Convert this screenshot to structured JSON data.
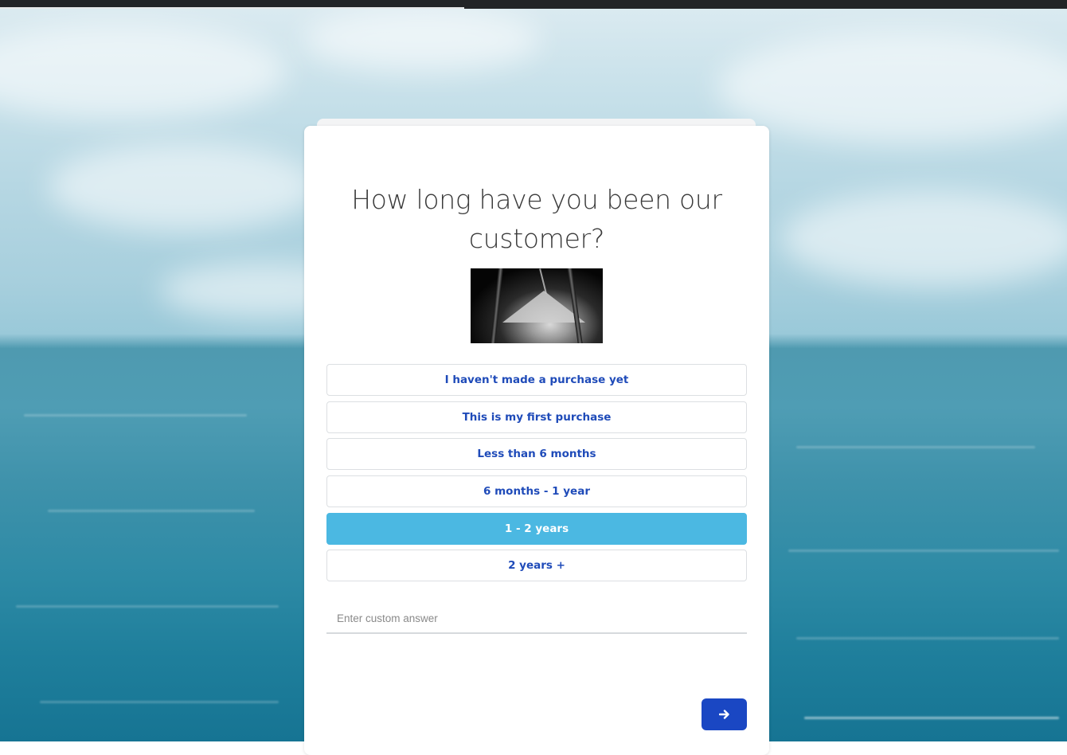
{
  "question": {
    "title": "How long have you been our customer?"
  },
  "image": {
    "icon": "hourglass-image",
    "description_hidden": ""
  },
  "options": [
    {
      "label": "I haven't made a purchase yet",
      "selected": false
    },
    {
      "label": "This is my first purchase",
      "selected": false
    },
    {
      "label": "Less than 6 months",
      "selected": false
    },
    {
      "label": "6 months - 1 year",
      "selected": false
    },
    {
      "label": "1 - 2 years",
      "selected": true
    },
    {
      "label": "2 years +",
      "selected": false
    }
  ],
  "custom_answer": {
    "value": "",
    "placeholder": "Enter custom answer"
  },
  "navigation": {
    "next_icon": "arrow-right-icon"
  },
  "progress": {
    "fraction": 0.435
  },
  "colors": {
    "accent": "#1a47c3",
    "selected": "#4bb8e2",
    "option_text": "#1f4bb9"
  }
}
